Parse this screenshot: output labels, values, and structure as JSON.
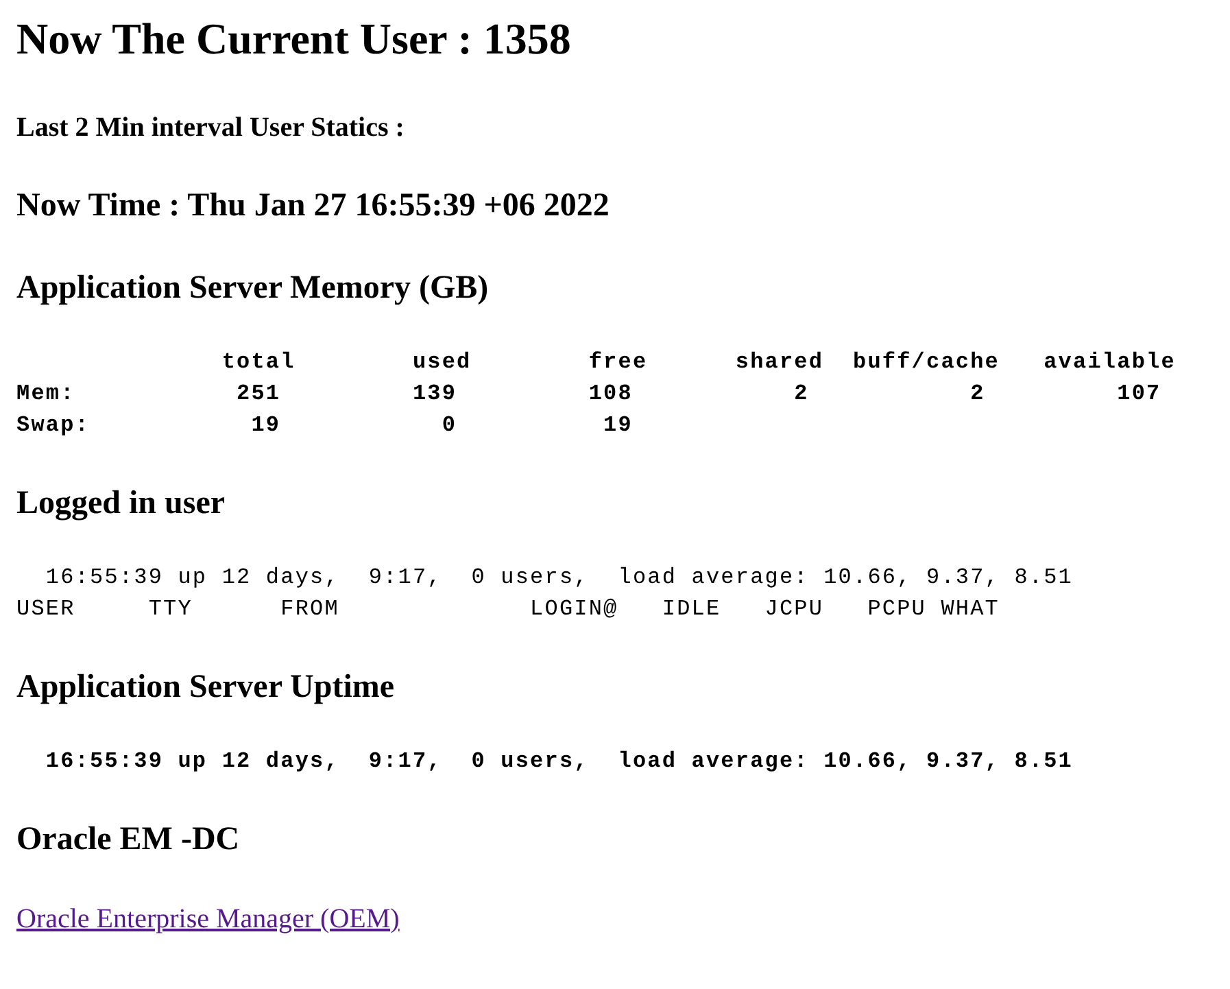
{
  "blocks": [
    {
      "kind": "h1",
      "text": "Now The Current User : 1358"
    },
    {
      "kind": "h4",
      "text": "Last 2 Min interval User Statics :"
    },
    {
      "kind": "h2",
      "text": "Now Time : Thu Jan 27 16:55:39 +06 2022"
    },
    {
      "kind": "h2",
      "text": "Application Server Memory (GB)"
    },
    {
      "kind": "pre",
      "bold": true,
      "lines": [
        "              total        used        free      shared  buff/cache   available",
        "Mem:           251         139         108           2           2         107",
        "Swap:           19           0          19"
      ]
    },
    {
      "kind": "h2",
      "text": "Logged in user"
    },
    {
      "kind": "pre",
      "bold": false,
      "lines": [
        "  16:55:39 up 12 days,  9:17,  0 users,  load average: 10.66, 9.37, 8.51",
        "USER     TTY      FROM             LOGIN@   IDLE   JCPU   PCPU WHAT"
      ]
    },
    {
      "kind": "h2",
      "text": "Application Server Uptime"
    },
    {
      "kind": "pre",
      "bold": true,
      "lines": [
        "  16:55:39 up 12 days,  9:17,  0 users,  load average: 10.66, 9.37, 8.51"
      ]
    },
    {
      "kind": "h2",
      "text": "Oracle EM -DC"
    },
    {
      "kind": "link",
      "text": "Oracle Enterprise Manager (OEM)"
    }
  ]
}
